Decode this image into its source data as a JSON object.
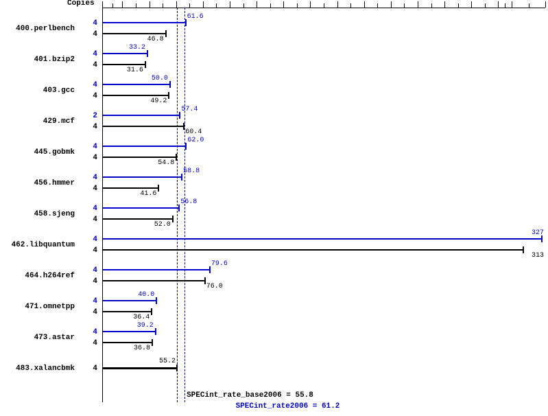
{
  "chart_data": {
    "type": "bar",
    "title": "",
    "xlabel": "",
    "ylabel": "",
    "xlim": [
      0,
      330
    ],
    "copies_header": "Copies",
    "ticks_major": [
      0,
      15.0,
      35.0,
      55.0,
      75.0,
      95.0,
      115.0,
      135.0,
      155.0,
      175.0,
      195.0,
      215.0,
      235.0,
      255.0,
      275.0,
      295.0,
      305.0,
      330
    ],
    "benchmarks": [
      {
        "name": "400.perlbench",
        "peak_copies": 4,
        "peak": 61.6,
        "base_copies": 4,
        "base": 46.8
      },
      {
        "name": "401.bzip2",
        "peak_copies": 4,
        "peak": 33.2,
        "base_copies": 4,
        "base": 31.6
      },
      {
        "name": "403.gcc",
        "peak_copies": 4,
        "peak": 50.0,
        "base_copies": 4,
        "base": 49.2
      },
      {
        "name": "429.mcf",
        "peak_copies": 2,
        "peak": 57.4,
        "base_copies": 4,
        "base": 60.4
      },
      {
        "name": "445.gobmk",
        "peak_copies": 4,
        "peak": 62.0,
        "base_copies": 4,
        "base": 54.8
      },
      {
        "name": "456.hmmer",
        "peak_copies": 4,
        "peak": 58.8,
        "base_copies": 4,
        "base": 41.6
      },
      {
        "name": "458.sjeng",
        "peak_copies": 4,
        "peak": 56.8,
        "base_copies": 4,
        "base": 52.0
      },
      {
        "name": "462.libquantum",
        "peak_copies": 4,
        "peak": 327,
        "base_copies": 4,
        "base": 313
      },
      {
        "name": "464.h264ref",
        "peak_copies": 4,
        "peak": 79.6,
        "base_copies": 4,
        "base": 76.0
      },
      {
        "name": "471.omnetpp",
        "peak_copies": 4,
        "peak": 40.0,
        "base_copies": 4,
        "base": 36.4
      },
      {
        "name": "473.astar",
        "peak_copies": 4,
        "peak": 39.2,
        "base_copies": 4,
        "base": 36.8
      },
      {
        "name": "483.xalancbmk",
        "copies": 4,
        "single": 55.2
      }
    ],
    "summary": {
      "base_label": "SPECint_rate_base2006 = 55.8",
      "peak_label": "SPECint_rate2006 = 61.2",
      "base_value": 55.8,
      "peak_value": 61.2
    }
  }
}
